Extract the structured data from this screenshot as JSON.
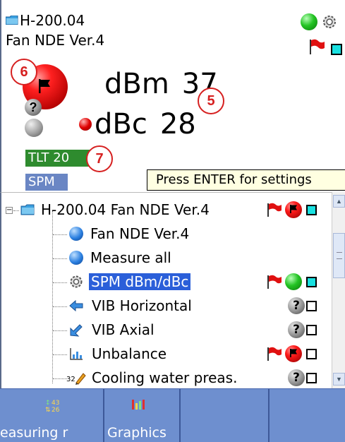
{
  "header": {
    "point_id": "H-200.04",
    "point_name": "Fan NDE Ver.4",
    "dbm_label": "dBm",
    "dbm_value": "37",
    "dbc_label": "dBc",
    "dbc_value": "28",
    "tlt_tag": "TLT 20",
    "spm_tag": "SPM",
    "tooltip": "Press ENTER for settings"
  },
  "callouts": {
    "c5": "5",
    "c6": "6",
    "c7": "7"
  },
  "tree": {
    "items": [
      {
        "label": "H-200.04 Fan NDE Ver.4",
        "icon": "folder-icon",
        "status": [
          "red-flag",
          "red-ball-flag",
          "cyan-square"
        ]
      },
      {
        "label": "Fan NDE Ver.4",
        "icon": "blue-ball-icon",
        "status": []
      },
      {
        "label": "Measure all",
        "icon": "blue-ball-icon",
        "status": []
      },
      {
        "label": "SPM dBm/dBc",
        "icon": "gear-icon",
        "selected": true,
        "status": [
          "red-flag",
          "green-ball",
          "cyan-square"
        ]
      },
      {
        "label": "VIB Horizontal",
        "icon": "arrow-left-icon",
        "status": [
          "gray-question",
          "white-square"
        ]
      },
      {
        "label": "VIB Axial",
        "icon": "axial-arrow-icon",
        "status": [
          "gray-question",
          "white-square"
        ]
      },
      {
        "label": "Unbalance",
        "icon": "chart-icon",
        "status": [
          "red-flag",
          "red-ball-flag",
          "white-square"
        ]
      },
      {
        "label": "Cooling water preas.",
        "icon": "pencil-icon",
        "status": [
          "gray-question",
          "white-square"
        ]
      }
    ],
    "gray_question_text": "?"
  },
  "toolbar": {
    "btn1_label": "easuring r",
    "btn2_label": "Graphics",
    "btn3_label": "",
    "btn4_label": ""
  },
  "colors": {
    "toolbar_bg": "#6e8fcf",
    "selection": "#2b5fd9",
    "tlt_green": "#2e8b2e",
    "spm_blue": "#6a86c4",
    "callout_red": "#d62020"
  }
}
